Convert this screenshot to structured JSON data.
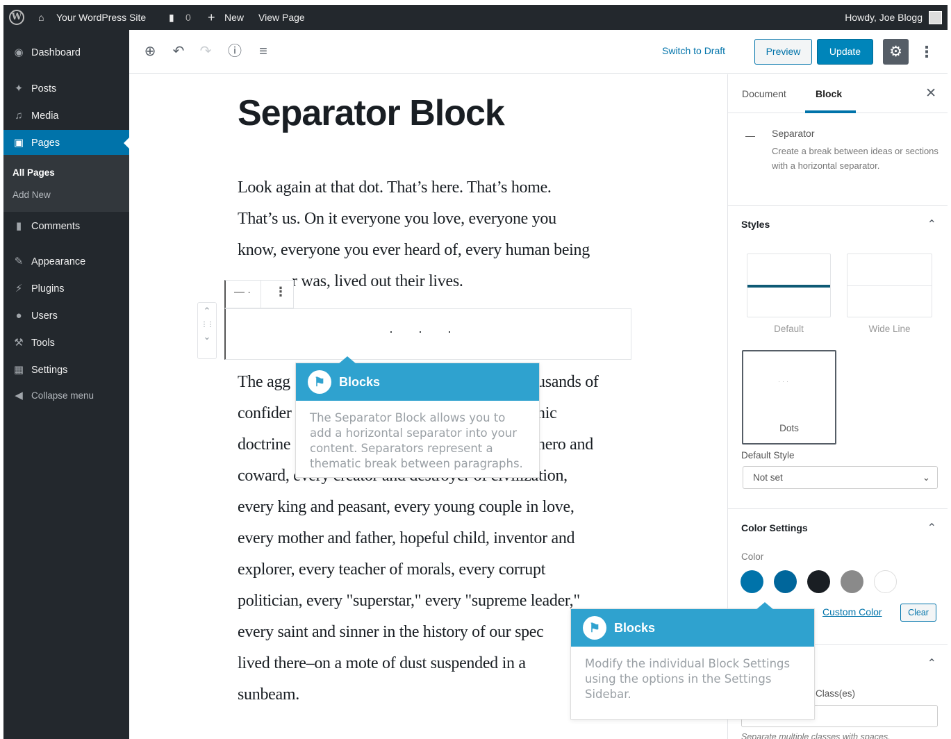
{
  "admin_bar": {
    "site_name": "Your WordPress Site",
    "comments_count": "0",
    "new_label": "New",
    "view_page": "View Page",
    "howdy": "Howdy, Joe Blogg"
  },
  "sidebar": {
    "dashboard": "Dashboard",
    "posts": "Posts",
    "media": "Media",
    "pages": "Pages",
    "all_pages": "All Pages",
    "add_new": "Add New",
    "comments": "Comments",
    "appearance": "Appearance",
    "plugins": "Plugins",
    "users": "Users",
    "tools": "Tools",
    "settings": "Settings",
    "collapse": "Collapse menu"
  },
  "toolbar": {
    "switch_to_draft": "Switch to Draft",
    "preview": "Preview",
    "update": "Update"
  },
  "content": {
    "title": "Separator Block",
    "para1": [
      "Look again at that dot. That’s here. That’s home.",
      "That’s us. On it everyone you love, everyone you",
      "know, everyone you ever heard of, every human being",
      "r was, lived out their lives."
    ],
    "para2_left": [
      "The agg",
      "confider",
      "doctrine"
    ],
    "para2_right": [
      "usands of",
      "nic",
      "hero and"
    ],
    "para2": [
      "coward, every creator and destroyer of civilization,",
      "every king and peasant, every young couple in love,",
      "every mother and father, hopeful child, inventor and",
      "explorer, every teacher of morals, every corrupt",
      "politician, every \"superstar,\" every \"supreme leader,\"",
      "every saint and sinner in the history of our spec",
      "lived there–on a mote of dust suspended in a",
      "sunbeam."
    ]
  },
  "tips": {
    "tip1_title": "Blocks",
    "tip1_text": "The Separator Block allows you to add a horizontal separator into your content. Separators represent a thematic break between paragraphs.",
    "tip2_title": "Blocks",
    "tip2_text": "Modify the individual Block Settings using the options in the Settings Sidebar."
  },
  "settings_panel": {
    "tab_document": "Document",
    "tab_block": "Block",
    "block_name": "Separator",
    "block_desc": "Create a break between ideas or sections with a horizontal separator.",
    "styles_title": "Styles",
    "style_default": "Default",
    "style_wide": "Wide Line",
    "style_dots": "Dots",
    "default_style_label": "Default Style",
    "default_style_value": "Not set",
    "color_settings_title": "Color Settings",
    "color_label": "Color",
    "custom_color": "Custom Color",
    "clear": "Clear",
    "classes_label": "Class(es)",
    "classes_help": "Separate multiple classes with spaces."
  },
  "colors": {
    "admin_dark": "#23282d",
    "accent": "#0073aa",
    "tip": "#2fa2cf",
    "swatches": [
      "#0073aa",
      "#00669b",
      "#191e23",
      "#8a8a8a",
      "#ffffff"
    ]
  }
}
